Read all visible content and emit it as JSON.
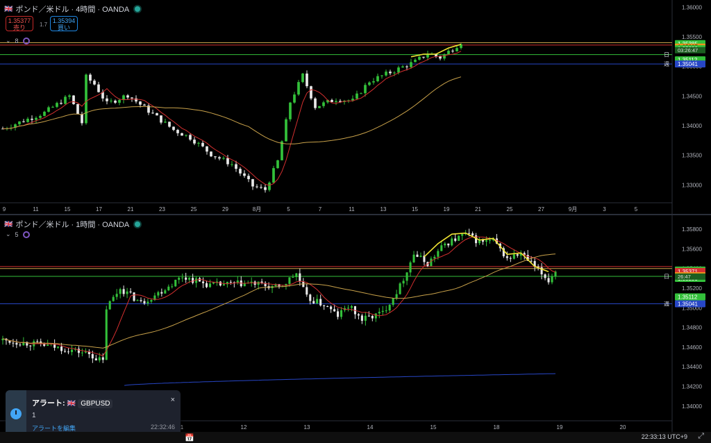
{
  "colors": {
    "up": "#33c03a",
    "down": "#e8e8e8",
    "ma_red": "#d32f2f",
    "ma_yellow": "#c9a24a",
    "ma_blue": "#2746c6",
    "zz": "#f0e433"
  },
  "pane1": {
    "title": "ポンド／米ドル · 4時間 · OANDA",
    "sell_price": "1.35377",
    "sell_label": "売り",
    "buy_price": "1.35394",
    "buy_label": "買い",
    "spread": "1.7",
    "indicator_count": "8",
    "time_labels": [
      "9",
      "11",
      "15",
      "17",
      "21",
      "23",
      "25",
      "29",
      "8月",
      "5",
      "7",
      "11",
      "13",
      "15",
      "19",
      "21",
      "25",
      "27",
      "9月",
      "3",
      "5"
    ],
    "marker_labels": [
      "日",
      "週"
    ]
  },
  "pane2": {
    "title": "ポンド／米ドル · 1時間 · OANDA",
    "indicator_count": "5",
    "time_labels": [
      "11",
      "12",
      "13",
      "14",
      "15",
      "18",
      "19",
      "20"
    ],
    "marker_labels": [
      "日",
      "週"
    ]
  },
  "chart_data": [
    {
      "type": "candlestick",
      "title": "ポンド／米ドル · 4時間 · OANDA",
      "ylim": [
        1.327,
        1.3605
      ],
      "y_ticks": [
        "1.36000",
        "1.35500",
        "1.35000",
        "1.34500",
        "1.34000",
        "1.33500",
        "1.33000"
      ],
      "x_labels": [
        "9",
        "11",
        "15",
        "17",
        "21",
        "23",
        "25",
        "29",
        "8月",
        "5",
        "7",
        "11",
        "13",
        "15",
        "19",
        "21",
        "25",
        "27",
        "9月",
        "3",
        "5"
      ],
      "close_path": [
        [
          0,
          1.3395
        ],
        [
          10,
          1.3422
        ],
        [
          16,
          1.345
        ],
        [
          19,
          1.3405
        ],
        [
          20,
          1.3482
        ],
        [
          22,
          1.347
        ],
        [
          25,
          1.3437
        ],
        [
          30,
          1.3452
        ],
        [
          35,
          1.3425
        ],
        [
          41,
          1.3393
        ],
        [
          45,
          1.338
        ],
        [
          50,
          1.3352
        ],
        [
          55,
          1.3335
        ],
        [
          60,
          1.3298
        ],
        [
          63,
          1.3292
        ],
        [
          66,
          1.334
        ],
        [
          69,
          1.344
        ],
        [
          72,
          1.3485
        ],
        [
          75,
          1.3432
        ],
        [
          80,
          1.3445
        ],
        [
          84,
          1.3442
        ],
        [
          88,
          1.3475
        ],
        [
          93,
          1.349
        ],
        [
          99,
          1.3508
        ],
        [
          102,
          1.3522
        ],
        [
          105,
          1.3515
        ],
        [
          108,
          1.353
        ],
        [
          110,
          1.3541
        ]
      ],
      "last_price": 1.35385,
      "countdown": "03:26:47",
      "price_labels": [
        {
          "value": 1.35385,
          "text": "1.35385",
          "color": "#33c03a"
        },
        {
          "value": 1.35327,
          "text": "1.35327",
          "color": "#f0931c"
        },
        {
          "value": 1.35299,
          "text": "1.35299",
          "color": "#33c03a"
        },
        {
          "value": 1.35112,
          "text": "1.35112",
          "color": "#33c03a"
        },
        {
          "value": 1.35041,
          "text": "1.35041",
          "color": "#2746c6"
        }
      ],
      "hlines": [
        {
          "value": 1.354,
          "color": "#c9a24a"
        },
        {
          "value": 1.3536,
          "color": "#d32f2f"
        },
        {
          "value": 1.352,
          "color": "#33c03a"
        },
        {
          "value": 1.35041,
          "color": "#2746c6"
        }
      ]
    },
    {
      "type": "candlestick",
      "title": "ポンド／米ドル · 1時間 · OANDA",
      "ylim": [
        1.3385,
        1.359
      ],
      "y_ticks": [
        "1.35800",
        "1.35600",
        "1.35400",
        "1.35200",
        "1.35000",
        "1.34800",
        "1.34600",
        "1.34400",
        "1.34200",
        "1.34000"
      ],
      "x_labels": [
        "11",
        "12",
        "13",
        "14",
        "15",
        "18",
        "19",
        "20"
      ],
      "close_path": [
        [
          0,
          1.3467
        ],
        [
          12,
          1.3462
        ],
        [
          20,
          1.3457
        ],
        [
          25,
          1.3453
        ],
        [
          29,
          1.3445
        ],
        [
          30,
          1.35
        ],
        [
          34,
          1.352
        ],
        [
          40,
          1.3505
        ],
        [
          45,
          1.3515
        ],
        [
          52,
          1.3532
        ],
        [
          60,
          1.3523
        ],
        [
          72,
          1.3525
        ],
        [
          80,
          1.352
        ],
        [
          85,
          1.3535
        ],
        [
          88,
          1.351
        ],
        [
          93,
          1.3503
        ],
        [
          97,
          1.3492
        ],
        [
          100,
          1.3502
        ],
        [
          104,
          1.3488
        ],
        [
          110,
          1.3495
        ],
        [
          115,
          1.3522
        ],
        [
          119,
          1.3555
        ],
        [
          123,
          1.3545
        ],
        [
          128,
          1.3565
        ],
        [
          134,
          1.3575
        ],
        [
          138,
          1.3567
        ],
        [
          142,
          1.3568
        ],
        [
          146,
          1.355
        ],
        [
          150,
          1.3555
        ],
        [
          155,
          1.3538
        ],
        [
          158,
          1.3528
        ],
        [
          160,
          1.3538
        ]
      ],
      "last_price": 1.35385,
      "countdown": "26:47",
      "price_labels": [
        {
          "value": 1.35385,
          "text": "1.35385",
          "color": "#33c03a"
        },
        {
          "value": 1.35371,
          "text": "1.35371",
          "color": "#d32f2f"
        },
        {
          "value": 1.35327,
          "text": "1.35327",
          "color": "#f0931c"
        },
        {
          "value": 1.35299,
          "text": "1.35299",
          "color": "#33c03a"
        },
        {
          "value": 1.35112,
          "text": "1.35112",
          "color": "#33c03a"
        },
        {
          "value": 1.35041,
          "text": "1.35041",
          "color": "#2746c6"
        }
      ],
      "hlines": [
        {
          "value": 1.3542,
          "color": "#d32f2f"
        },
        {
          "value": 1.354,
          "color": "#c9a24a"
        },
        {
          "value": 1.3532,
          "color": "#33c03a"
        },
        {
          "value": 1.35041,
          "color": "#2746c6"
        }
      ]
    }
  ],
  "alert": {
    "title": "アラート:",
    "symbol": "GBPUSD",
    "message": "1",
    "edit_label": "アラートを編集",
    "time": "22:32:46",
    "close": "×"
  },
  "status": {
    "clock": "22:33:13 UTC+9"
  }
}
